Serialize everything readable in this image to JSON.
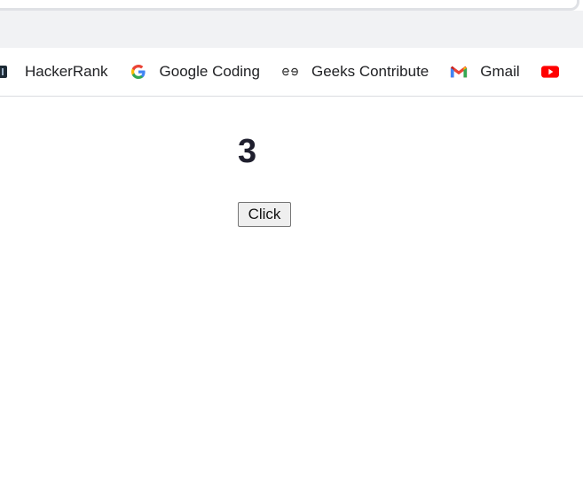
{
  "bookmarks": [
    {
      "label": "HackerRank",
      "icon": "hackerrank-icon"
    },
    {
      "label": "Google Coding",
      "icon": "google-icon"
    },
    {
      "label": "Geeks Contribute",
      "icon": "geeksforgeeks-icon"
    },
    {
      "label": "Gmail",
      "icon": "gmail-icon"
    },
    {
      "label": "",
      "icon": "youtube-icon"
    }
  ],
  "page": {
    "counter_value": "3",
    "button_label": "Click"
  },
  "colors": {
    "chrome_bg": "#f1f2f4",
    "text": "#202124",
    "counter_text": "#1f1f2e",
    "youtube_red": "#ff0000"
  }
}
